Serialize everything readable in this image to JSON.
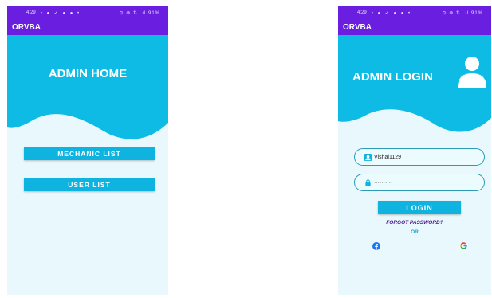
{
  "left_screen": {
    "status_time": "4:29",
    "status_icons": "• ● ✓ ● ● •",
    "status_right": "⊙ ⊗ ⇅ .ıl 91%",
    "app_title": "ORVBA",
    "hero_title": "ADMIN HOME",
    "buttons": {
      "mechanic": "MECHANIC LIST",
      "user": "USER LIST"
    }
  },
  "right_screen": {
    "status_time": "4:29",
    "status_icons": "• ● ✓ ● ● •",
    "status_right": "⊙ ⊗ ⇅ .ıl 91%",
    "app_title": "ORVBA",
    "hero_title": "ADMIN LOGIN",
    "username_value": "Vishal1129",
    "password_value": "··········",
    "login_label": "LOGIN",
    "forgot_label": "FORGOT PASSWORD?",
    "or_label": "OR",
    "icons": [
      "user-avatar-icon",
      "person-icon",
      "lock-icon",
      "facebook-icon",
      "google-icon"
    ]
  },
  "colors": {
    "app_bar": "#6a1fe0",
    "hero": "#0dbbe5",
    "background": "#e8f8fc",
    "button": "#0fb3e0",
    "forgot_text": "#4b148f"
  }
}
